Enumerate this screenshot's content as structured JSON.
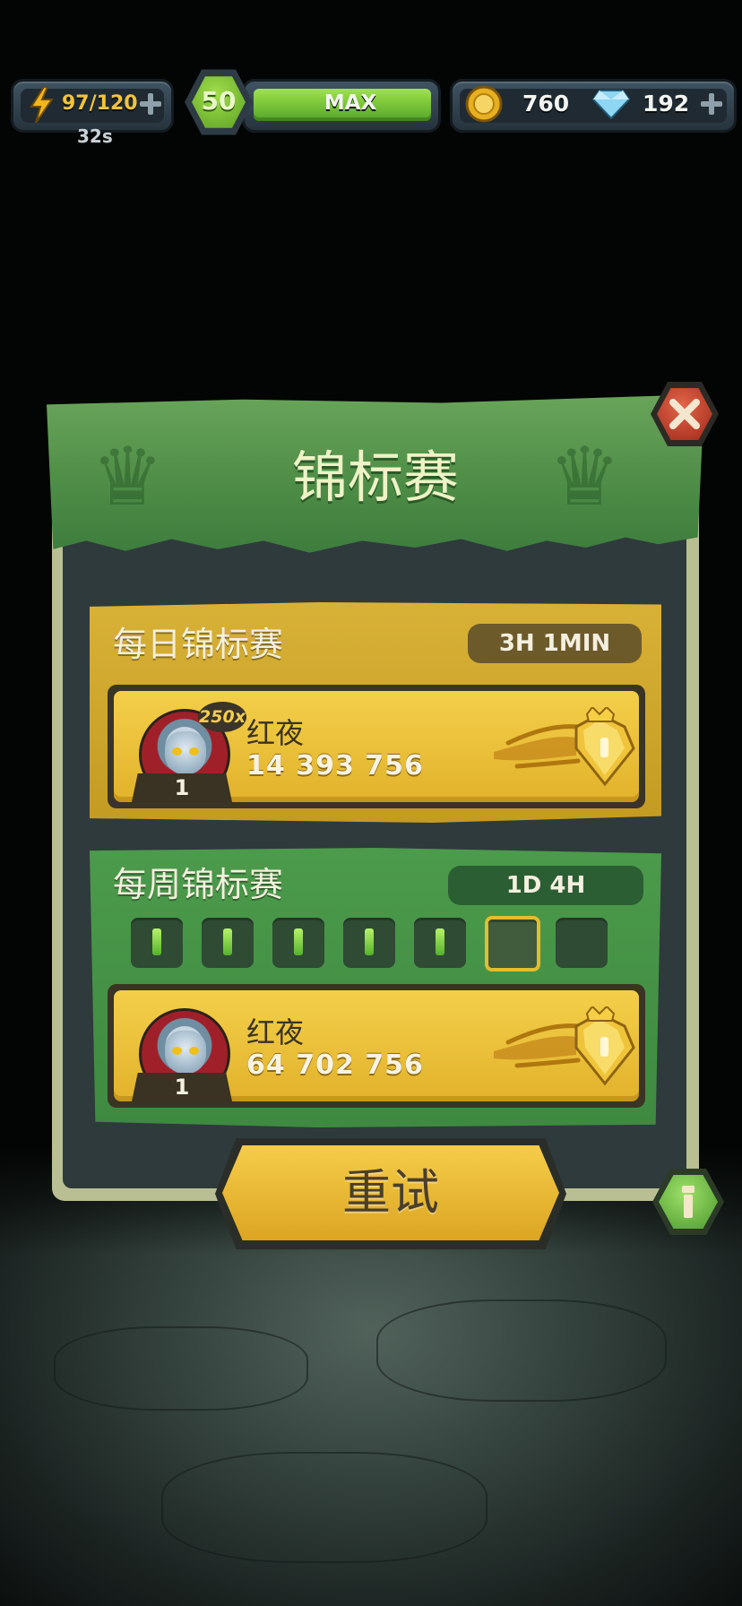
{
  "hud": {
    "energy": "97/120",
    "energy_timer": "32s",
    "level": "50",
    "xp_label": "MAX",
    "coins": "760",
    "gems": "192",
    "energy_icon": "lightning-icon",
    "coin_icon": "coin-icon",
    "gem_icon": "diamond-icon"
  },
  "panel": {
    "title": "锦标赛",
    "close_icon": "close-icon"
  },
  "daily": {
    "title": "每日锦标赛",
    "timer": "3H 1MIN",
    "player": {
      "name": "红夜",
      "score": "14 393 756",
      "rank": "1",
      "multiplier": "250x"
    }
  },
  "weekly": {
    "title": "每周锦标赛",
    "timer": "1D 4H",
    "progress": {
      "completed": 5,
      "total": 7
    },
    "player": {
      "name": "红夜",
      "score": "64 702 756",
      "rank": "1"
    }
  },
  "buttons": {
    "retry": "重试",
    "info_icon": "info-icon"
  },
  "colors": {
    "gold": "#e8b82c",
    "green": "#4c9a4b",
    "red": "#b63a26",
    "dark": "#2f3a3c"
  }
}
